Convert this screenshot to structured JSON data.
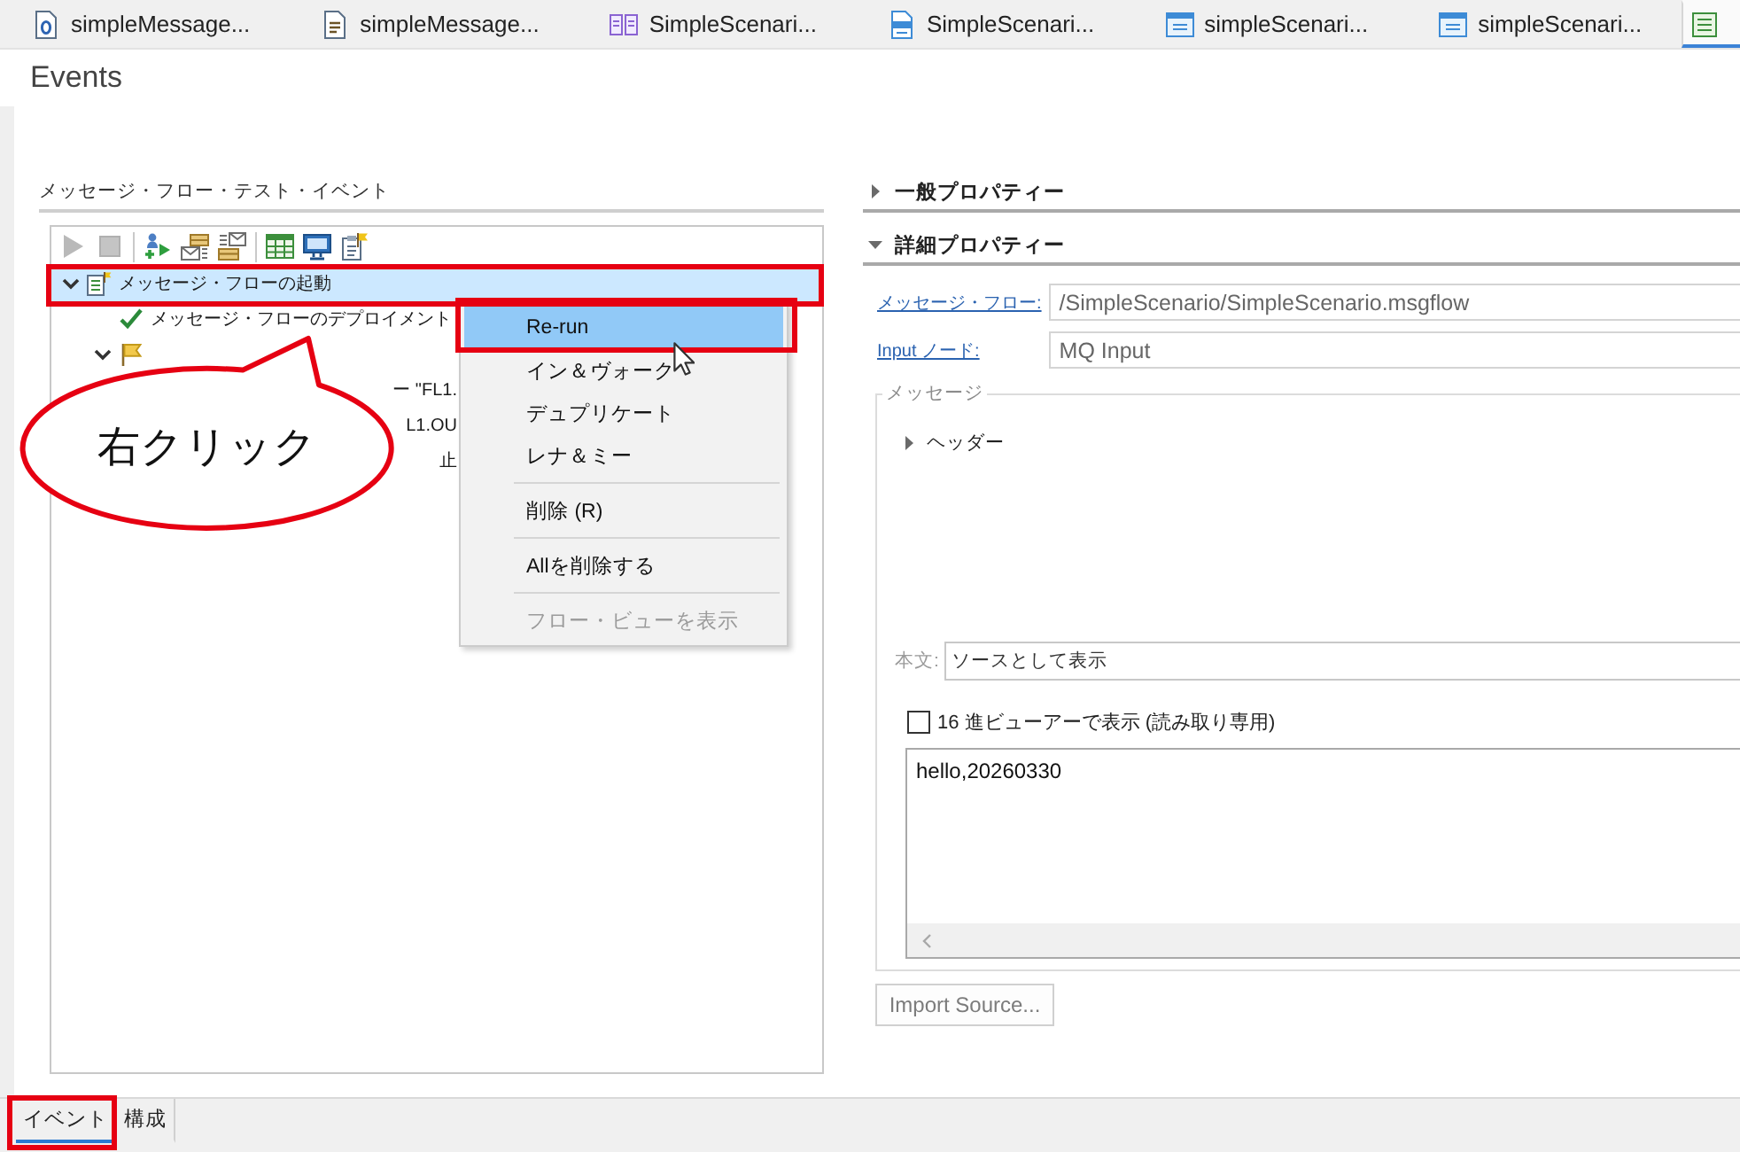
{
  "editor_tabs": [
    {
      "kind": "doc-ring",
      "label": "simpleMessage...",
      "selected": false
    },
    {
      "kind": "doc-lines",
      "label": "simpleMessage...",
      "selected": false
    },
    {
      "kind": "flow",
      "label": "SimpleScenari...",
      "selected": false
    },
    {
      "kind": "esql",
      "label": "SimpleScenari...",
      "selected": false
    },
    {
      "kind": "form",
      "label": "simpleScenari...",
      "selected": false
    },
    {
      "kind": "form",
      "label": "simpleScenari...",
      "selected": false
    },
    {
      "kind": "sheet",
      "selected": true
    }
  ],
  "view": {
    "title": "Events"
  },
  "left_panel": {
    "title": "メッセージ・フロー・テスト・イベント",
    "toolbar": [
      {
        "buttons": [
          {
            "kind": "run",
            "disabled": true
          },
          {
            "kind": "stop",
            "disabled": true
          }
        ]
      },
      {
        "buttons": [
          {
            "kind": "person-arrow",
            "disabled": false
          },
          {
            "kind": "envelope-stack",
            "disabled": false
          },
          {
            "kind": "envelope-list",
            "disabled": false
          }
        ]
      },
      {
        "buttons": [
          {
            "kind": "table",
            "disabled": false
          },
          {
            "kind": "monitor",
            "disabled": false
          },
          {
            "kind": "clipboard",
            "disabled": false
          }
        ]
      }
    ],
    "tree": [
      {
        "kind": "invoke",
        "label": "メッセージ・フローの起動",
        "selected": true,
        "expanded": true,
        "children": [
          {
            "kind": "success",
            "label": "メッセージ・フローのデプロイメント",
            "selected": false
          },
          {
            "kind": "start",
            "selected": false,
            "expanded": true,
            "children": [
              {
                "label": "ー \"FL1.",
                "selected": false
              },
              {
                "label": "L1.OU",
                "selected": false
              },
              {
                "label": "止",
                "selected": false
              }
            ]
          }
        ]
      }
    ]
  },
  "context_menu": {
    "items": [
      {
        "kind": "item",
        "label": "Re-run",
        "selected": true,
        "disabled": false
      },
      {
        "kind": "item",
        "label": "イン＆ヴォーク",
        "selected": false,
        "disabled": false
      },
      {
        "kind": "item",
        "label": "デュプリケート",
        "selected": false,
        "disabled": false
      },
      {
        "kind": "item",
        "label": "レナ＆ミー",
        "selected": false,
        "disabled": false
      },
      {
        "kind": "separator"
      },
      {
        "kind": "item",
        "label": "削除 (R)",
        "selected": false,
        "disabled": false
      },
      {
        "kind": "separator"
      },
      {
        "kind": "item",
        "label": "Allを削除する",
        "selected": false,
        "disabled": false
      },
      {
        "kind": "separator"
      },
      {
        "kind": "item",
        "label": "フロー・ビューを表示",
        "selected": false,
        "disabled": true
      }
    ]
  },
  "callout": {
    "text": "右クリック"
  },
  "properties": {
    "sections": [
      {
        "title": "一般プロパティー",
        "expanded": false
      },
      {
        "title": "詳細プロパティー",
        "expanded": true,
        "fields": [
          {
            "label": "メッセージ・フロー:",
            "value": "/SimpleScenario/SimpleScenario.msgflow"
          },
          {
            "label": "Input ノード:",
            "value": "MQ Input"
          }
        ],
        "message": {
          "title": "メッセージ",
          "header": {
            "label": "ヘッダー",
            "expanded": false
          },
          "body_label": "本文:",
          "body_mode": "ソースとして表示",
          "hex_view": {
            "label": "16 進ビューアーで表示 (読み取り専用)",
            "checked": false
          },
          "content": "hello,20260330"
        }
      }
    ],
    "import_button": {
      "label": "Import Source...",
      "disabled": true
    }
  },
  "bottom_tabs": [
    {
      "label": "イベント",
      "selected": true
    },
    {
      "label": "構成",
      "selected": false
    }
  ]
}
